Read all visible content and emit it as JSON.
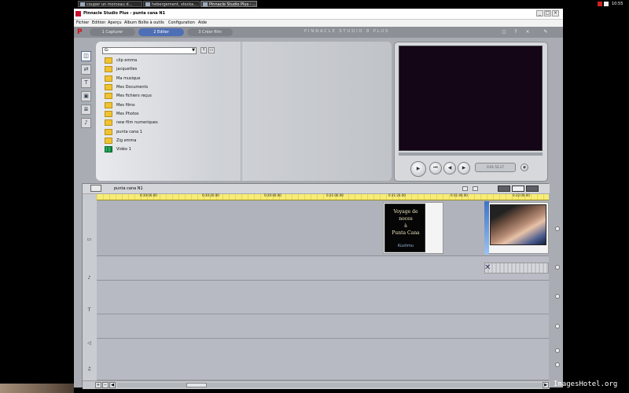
{
  "taskbar": {
    "tasks": [
      {
        "label": "couper un morceau d..."
      },
      {
        "label": "hebergement, stocka..."
      },
      {
        "label": "Pinnacle Studio Plus - ..."
      }
    ],
    "clock": "10:55"
  },
  "window": {
    "title": "Pinnacle Studio Plus - punta cana N1",
    "controls": [
      "_",
      "□",
      "×"
    ]
  },
  "menu": [
    "Fichier",
    "Edition",
    "Aperçu",
    "Album",
    "Boîte à outils",
    "Configuration",
    "Aide"
  ],
  "modes": [
    {
      "label": "1 Capturer",
      "active": false
    },
    {
      "label": "2 Editer",
      "active": true
    },
    {
      "label": "3 Créer film",
      "active": false
    }
  ],
  "brand": "PINNACLE STUDIO 8 PLUS",
  "album": {
    "path": "G:",
    "folders": [
      {
        "name": "clip emma",
        "type": "folder"
      },
      {
        "name": "jacquettes",
        "type": "folder"
      },
      {
        "name": "Ma musique",
        "type": "folder"
      },
      {
        "name": "Mes Documents",
        "type": "folder"
      },
      {
        "name": "Mes fichiers reçus",
        "type": "folder"
      },
      {
        "name": "Mes films",
        "type": "folder"
      },
      {
        "name": "Mes Photos",
        "type": "folder"
      },
      {
        "name": "new film numeriques",
        "type": "folder"
      },
      {
        "name": "punta cana 1",
        "type": "folder"
      },
      {
        "name": "Zig emma",
        "type": "folder"
      },
      {
        "name": "Vidéo 1",
        "type": "video"
      }
    ]
  },
  "player": {
    "timecode": "0:01:53.17"
  },
  "timeline": {
    "project": "punta cana N1",
    "ruler": [
      "0:30:00.00",
      "0:30:20.00",
      "0:30:40.00",
      "0:31:00.00",
      "0:31:20.00",
      "0:31:40.00",
      "0:32:00.00"
    ],
    "title_clip": {
      "lines": [
        "Voyage de noces",
        "à",
        "Punta Cana"
      ],
      "strip": "Kushmu"
    }
  },
  "watermark": "ImagesHotel.org"
}
